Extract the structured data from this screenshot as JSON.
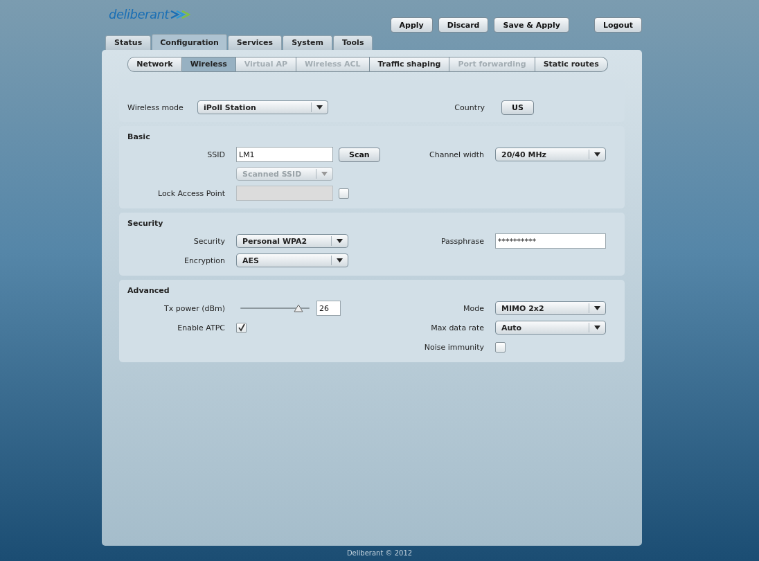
{
  "logo": {
    "text": "deliberant"
  },
  "header_buttons": [
    "Apply",
    "Discard",
    "Save & Apply",
    "Logout"
  ],
  "tabs": [
    {
      "label": "Status",
      "selected": false
    },
    {
      "label": "Configuration",
      "selected": true
    },
    {
      "label": "Services",
      "selected": false
    },
    {
      "label": "System",
      "selected": false
    },
    {
      "label": "Tools",
      "selected": false
    }
  ],
  "subtabs": [
    {
      "label": "Network",
      "selected": false,
      "disabled": false
    },
    {
      "label": "Wireless",
      "selected": true,
      "disabled": false
    },
    {
      "label": "Virtual AP",
      "selected": false,
      "disabled": true
    },
    {
      "label": "Wireless ACL",
      "selected": false,
      "disabled": true
    },
    {
      "label": "Traffic shaping",
      "selected": false,
      "disabled": false
    },
    {
      "label": "Port forwarding",
      "selected": false,
      "disabled": true
    },
    {
      "label": "Static routes",
      "selected": false,
      "disabled": false
    }
  ],
  "sections": [
    {
      "left": [
        {
          "label": "Wireless mode",
          "controls": [
            {
              "kind": "select",
              "value": "iPoll Station",
              "disabled": false
            }
          ]
        }
      ],
      "right": [
        {
          "label": "Country",
          "controls": [
            {
              "kind": "button",
              "label": "US"
            }
          ]
        }
      ]
    },
    {
      "title": "Basic",
      "left": [
        {
          "label": "SSID",
          "controls": [
            {
              "kind": "input",
              "value": "LM1",
              "disabled": false
            },
            {
              "kind": "button",
              "label": "Scan"
            }
          ]
        },
        {
          "controls": [
            {
              "kind": "select",
              "value": "Scanned SSID",
              "disabled": true
            }
          ]
        },
        {
          "label": "Lock Access Point",
          "controls": [
            {
              "kind": "input",
              "disabled": true
            },
            {
              "kind": "checkbox",
              "checked": false
            }
          ]
        }
      ],
      "right": [
        {
          "label": "Channel width",
          "controls": [
            {
              "kind": "select",
              "value": "20/40 MHz",
              "disabled": false
            }
          ]
        }
      ]
    },
    {
      "title": "Security",
      "left": [
        {
          "label": "Security",
          "controls": [
            {
              "kind": "select",
              "value": "Personal WPA2",
              "disabled": false
            }
          ]
        },
        {
          "label": "Encryption",
          "controls": [
            {
              "kind": "select",
              "value": "AES",
              "disabled": false
            }
          ]
        }
      ],
      "right": [
        {
          "label": "Passphrase",
          "controls": [
            {
              "kind": "input",
              "value": "**********",
              "disabled": false
            }
          ]
        }
      ]
    },
    {
      "title": "Advanced",
      "left": [
        {
          "label": "Tx power (dBm)",
          "controls": [
            {
              "kind": "slider",
              "level": 0.9
            },
            {
              "kind": "input",
              "value": "26",
              "disabled": false
            }
          ]
        },
        {
          "label": "Enable ATPC",
          "controls": [
            {
              "kind": "checkbox",
              "checked": true
            }
          ]
        }
      ],
      "right": [
        {
          "label": "Mode",
          "controls": [
            {
              "kind": "select",
              "value": "MIMO 2x2",
              "disabled": false
            }
          ]
        },
        {
          "label": "Max data rate",
          "controls": [
            {
              "kind": "select",
              "value": "Auto",
              "disabled": false
            }
          ]
        },
        {
          "label": "Noise immunity",
          "controls": [
            {
              "kind": "checkbox",
              "checked": false
            }
          ]
        }
      ]
    }
  ],
  "footer": "Deliberant © 2012"
}
